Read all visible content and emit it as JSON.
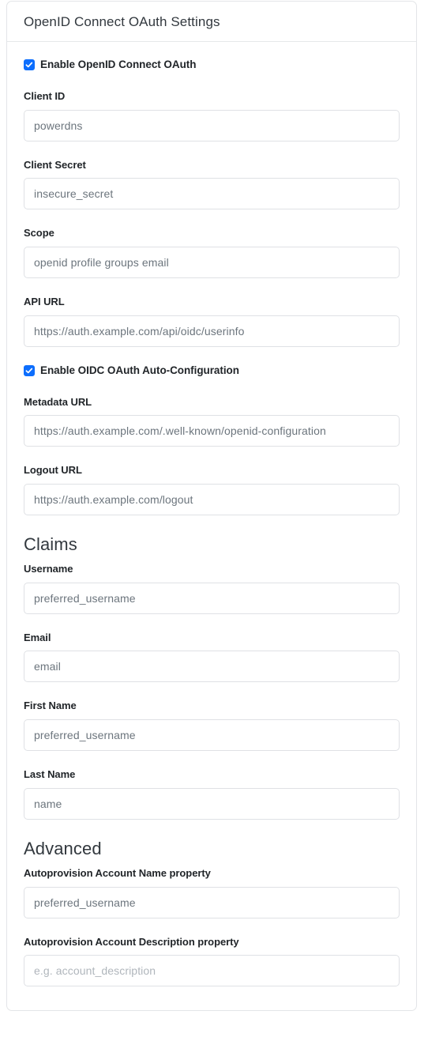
{
  "card": {
    "header_title": "OpenID Connect OAuth Settings"
  },
  "toggles": {
    "enable_oauth": {
      "label": "Enable OpenID Connect OAuth",
      "checked": true,
      "icon": "check-icon"
    },
    "enable_autoconfig": {
      "label": "Enable OIDC OAuth Auto-Configuration",
      "checked": true,
      "icon": "check-icon"
    }
  },
  "fields": {
    "client_id": {
      "label": "Client ID",
      "value": "powerdns",
      "is_placeholder": false
    },
    "client_secret": {
      "label": "Client Secret",
      "value": "insecure_secret",
      "is_placeholder": false
    },
    "scope": {
      "label": "Scope",
      "value": "openid profile groups email",
      "is_placeholder": false
    },
    "api_url": {
      "label": "API URL",
      "value": "https://auth.example.com/api/oidc/userinfo",
      "is_placeholder": false
    },
    "metadata_url": {
      "label": "Metadata URL",
      "value": "https://auth.example.com/.well-known/openid-configuration",
      "is_placeholder": false
    },
    "logout_url": {
      "label": "Logout URL",
      "value": "https://auth.example.com/logout",
      "is_placeholder": false
    },
    "claim_username": {
      "label": "Username",
      "value": "preferred_username",
      "is_placeholder": false
    },
    "claim_email": {
      "label": "Email",
      "value": "email",
      "is_placeholder": false
    },
    "claim_first_name": {
      "label": "First Name",
      "value": "preferred_username",
      "is_placeholder": false
    },
    "claim_last_name": {
      "label": "Last Name",
      "value": "name",
      "is_placeholder": false
    },
    "autoprovision_account_name": {
      "label": "Autoprovision Account Name property",
      "value": "preferred_username",
      "is_placeholder": false
    },
    "autoprovision_account_description": {
      "label": "Autoprovision Account Description property",
      "value": "e.g. account_description",
      "is_placeholder": true
    }
  },
  "sections": {
    "claims_heading": "Claims",
    "advanced_heading": "Advanced"
  },
  "colors": {
    "accent": "#0d6efd",
    "card_border": "#e3e5e8",
    "input_border": "#dfe1e5",
    "text": "#212529",
    "value_text": "#6c757d",
    "placeholder_text": "#b0b6bc"
  }
}
